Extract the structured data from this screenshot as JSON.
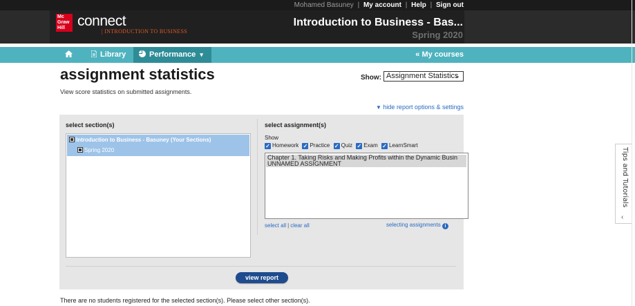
{
  "topbar": {
    "user": "Mohamed Basuney",
    "my_account": "My account",
    "help": "Help",
    "sign_out": "Sign out",
    "sep": "|"
  },
  "header": {
    "logo_text": "Mc Graw Hill",
    "brand": "connect",
    "subtitle": "INTRODUCTION TO BUSINESS",
    "course_title": "Introduction to Business - Bas...",
    "term": "Spring 2020",
    "brand_color": "#d6001c"
  },
  "nav": {
    "home_icon": "home-icon",
    "library": "Library",
    "performance": "Performance",
    "my_courses": "« My courses",
    "accent": "#4fb3bf"
  },
  "page": {
    "title": "assignment statistics",
    "subtitle": "View score statistics on submitted assignments.",
    "show_label": "Show:",
    "show_value": "Assignment Statistics",
    "hide_link": "hide report options & settings"
  },
  "sections": {
    "label": "select section(s)",
    "items": [
      "Introduction to Business - Basuney (Your Sections)",
      "Spring 2020"
    ]
  },
  "assignments": {
    "label": "select assignment(s)",
    "show": "Show",
    "filters": [
      "Homework",
      "Practice",
      "Quiz",
      "Exam",
      "LearnSmart"
    ],
    "items": [
      "Chapter 1. Taking Risks and Making Profits within the Dynamic Busin",
      "UNNAMED ASSIGNMENT"
    ],
    "select_all": "select all",
    "clear_all": "clear all",
    "sep": "|",
    "help": "selecting assignments"
  },
  "actions": {
    "view_report": "view report"
  },
  "message": "There are no students registered for the selected section(s). Please select other section(s).",
  "side_tab": {
    "label": "Tips and Tutorials"
  }
}
